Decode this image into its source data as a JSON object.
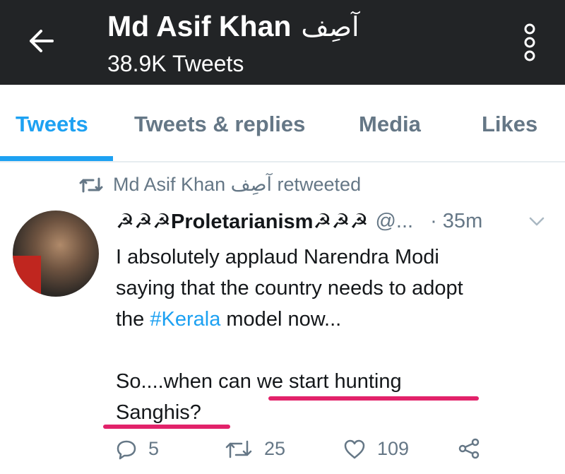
{
  "header": {
    "title": "Md Asif Khan",
    "title_urdu": "آصِف",
    "tweet_count": "38.9K Tweets",
    "back_icon": "arrow-left-icon",
    "menu_icon": "vertical-dots-icon"
  },
  "tabs": [
    {
      "label": "Tweets",
      "active": true
    },
    {
      "label": "Tweets & replies",
      "active": false
    },
    {
      "label": "Media",
      "active": false
    },
    {
      "label": "Likes",
      "active": false
    }
  ],
  "retweet": {
    "name": "Md Asif Khan",
    "name_urdu": "آصِف",
    "suffix": "retweeted"
  },
  "tweet": {
    "display_name": "☭☭☭Proletarianism☭☭☭",
    "handle": "@...",
    "time": "· 35m",
    "line1": "I absolutely applaud Narendra Modi",
    "line2": "saying that the country needs to adopt",
    "line3_before": "the ",
    "hashtag": "#Kerala",
    "line3_after": " model now...",
    "line4": "So....when can we start hunting",
    "line5": "Sanghis?",
    "replies": "5",
    "retweets": "25",
    "likes": "109"
  },
  "colors": {
    "accent": "#1da1f2",
    "header_bg": "#222426",
    "muted": "#657786",
    "highlight_underline": "#e2226a"
  }
}
